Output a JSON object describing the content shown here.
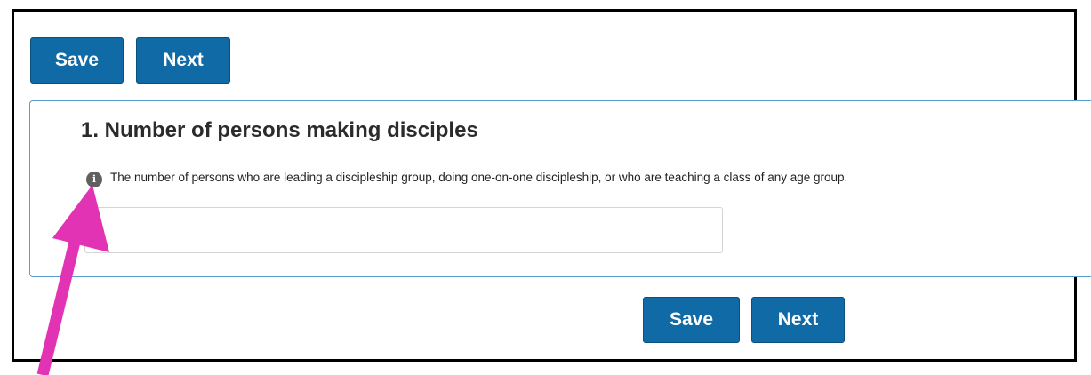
{
  "top_toolbar": {
    "save_label": "Save",
    "next_label": "Next"
  },
  "question": {
    "title": "1. Number of persons making disciples",
    "description": "The number of persons who are leading a discipleship group, doing one-on-one discipleship, or who are teaching a class of any age group.",
    "info_icon_glyph": "i",
    "input_value": "",
    "input_placeholder": ""
  },
  "bottom_toolbar": {
    "save_label": "Save",
    "next_label": "Next"
  },
  "colors": {
    "button_bg": "#0f6aa6",
    "card_border": "#5a9fd0",
    "annotation_arrow": "#e233b4",
    "frame_border": "#000000"
  },
  "icons": {
    "info": "info-icon",
    "annotation": "annotation-arrow-icon"
  }
}
